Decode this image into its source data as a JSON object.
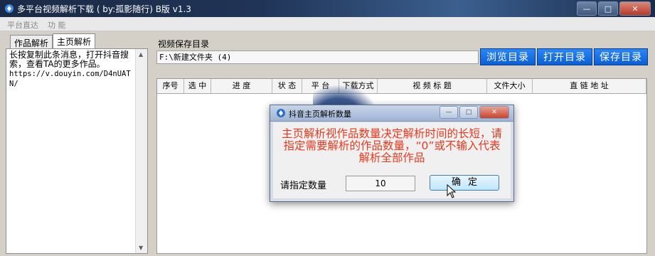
{
  "window": {
    "title": "多平台视频解析下载 ( by:孤影随行) B版 v1.3"
  },
  "menu": [
    "平台直达",
    "功 能"
  ],
  "left": {
    "tabs": [
      "作品解析",
      "主页解析"
    ],
    "text": "长按复制此条消息，打开抖音搜索，查看TA的更多作品。",
    "url": "https://v.douyin.com/D4nUATN/"
  },
  "save": {
    "label": "视频保存目录",
    "path": "F:\\新建文件夹 (4)",
    "buttons": [
      "浏览目录",
      "打开目录",
      "保存目录"
    ]
  },
  "table": {
    "columns": [
      "序号",
      "选 中",
      "进 度",
      "状 态",
      "平 台",
      "下载方式",
      "视 频 标 题",
      "文件大小",
      "直 链 地 址"
    ]
  },
  "dialog": {
    "title": "抖音主页解析数量",
    "message": "主页解析视作品数量决定解析时间的长短，请指定需要解析的作品数量，“0”或不输入代表解析全部作品",
    "count_label": "请指定数量",
    "count_value": "10",
    "ok_label": "确定"
  },
  "colors": {
    "accent_button": "#0a5fd4",
    "dialog_message": "#e8391e"
  }
}
